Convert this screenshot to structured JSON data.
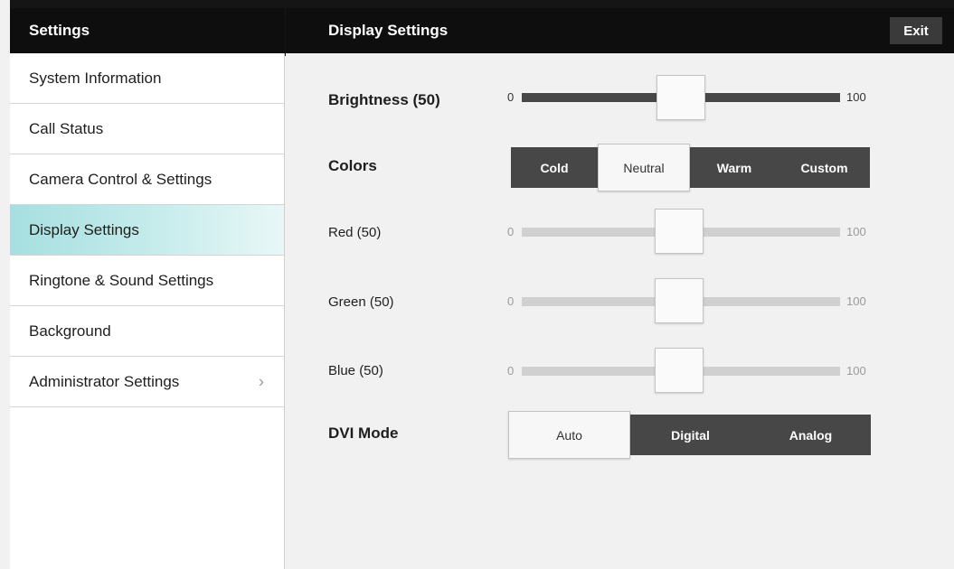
{
  "header": {
    "settings_title": "Settings",
    "page_title": "Display Settings",
    "exit_label": "Exit"
  },
  "sidebar": {
    "items": [
      {
        "label": "System Information"
      },
      {
        "label": "Call Status"
      },
      {
        "label": "Camera Control & Settings"
      },
      {
        "label": "Display Settings",
        "active": true
      },
      {
        "label": "Ringtone & Sound Settings"
      },
      {
        "label": "Background"
      },
      {
        "label": "Administrator Settings",
        "chevron": "chevron-right-icon"
      }
    ]
  },
  "brightness": {
    "label": "Brightness (50)",
    "min": "0",
    "max": "100",
    "value": 50
  },
  "colors": {
    "label": "Colors",
    "options": [
      "Cold",
      "Neutral",
      "Warm",
      "Custom"
    ],
    "selected": "Neutral"
  },
  "red": {
    "label": "Red (50)",
    "min": "0",
    "max": "100",
    "value": 50
  },
  "green": {
    "label": "Green (50)",
    "min": "0",
    "max": "100",
    "value": 50
  },
  "blue": {
    "label": "Blue (50)",
    "min": "0",
    "max": "100",
    "value": 50
  },
  "dvi": {
    "label": "DVI Mode",
    "options": [
      "Auto",
      "Digital",
      "Analog"
    ],
    "selected": "Auto"
  },
  "colors_theme": {
    "accent": "#a6dfe0",
    "header": "#0e0e0e",
    "track_dark": "#474747",
    "track_light": "#d0d0d0"
  }
}
